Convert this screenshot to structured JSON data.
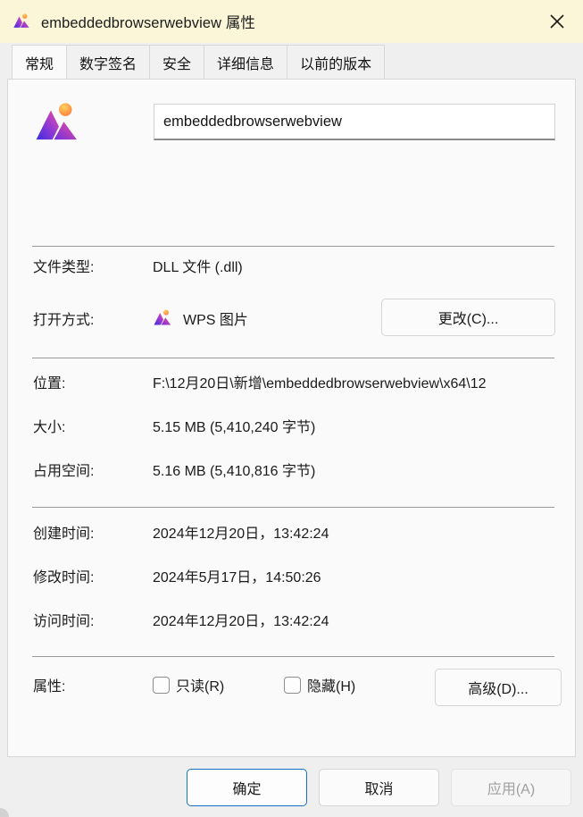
{
  "window": {
    "title": "embeddedbrowserwebview 属性",
    "icon": "wps-photos-icon",
    "close_label": "✕",
    "titlebar_color": "#faf6d7"
  },
  "tabs": [
    {
      "label": "常规",
      "active": true
    },
    {
      "label": "数字签名",
      "active": false
    },
    {
      "label": "安全",
      "active": false
    },
    {
      "label": "详细信息",
      "active": false
    },
    {
      "label": "以前的版本",
      "active": false
    }
  ],
  "general": {
    "file_name": "embeddedbrowserwebview",
    "file_icon": "wps-photos-icon",
    "fields": [
      {
        "label": "文件类型:",
        "value": "DLL 文件 (.dll)"
      },
      {
        "label": "打开方式:",
        "value": "WPS 图片"
      },
      {
        "label": "位置:",
        "value": "F:\\12月20日\\新增\\embeddedbrowserwebview\\x64\\12"
      },
      {
        "label": "大小:",
        "value": "5.15 MB (5,410,240 字节)"
      },
      {
        "label": "占用空间:",
        "value": "5.16 MB (5,410,816 字节)"
      },
      {
        "label": "创建时间:",
        "value": "2024年12月20日，13:42:24"
      },
      {
        "label": "修改时间:",
        "value": "2024年5月17日，14:50:26"
      },
      {
        "label": "访问时间:",
        "value": "2024年12月20日，13:42:24"
      },
      {
        "label": "属性:",
        "value": ""
      }
    ],
    "change_button": "更改(C)...",
    "advanced_button": "高级(D)...",
    "attributes": [
      {
        "label": "只读(R)",
        "checked": false
      },
      {
        "label": "隐藏(H)",
        "checked": false
      }
    ]
  },
  "footer": {
    "ok": "确定",
    "cancel": "取消",
    "apply": "应用(A)",
    "apply_enabled": false,
    "focus_color": "#1273c4"
  }
}
